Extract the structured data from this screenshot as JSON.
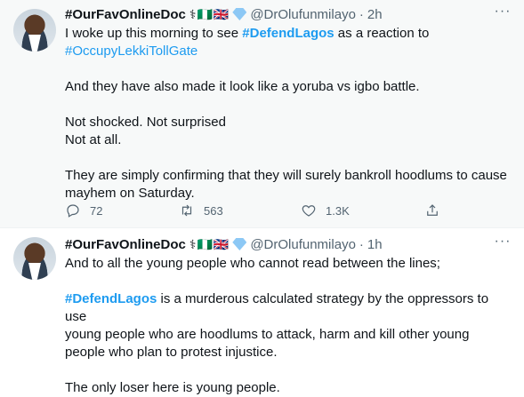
{
  "tweets": [
    {
      "name": "#OurFavOnlineDoc",
      "badges": "⚕🇳🇬🇬🇧",
      "handle": "@DrOlufunmilayo",
      "separator": "·",
      "time": "2h",
      "line1_prefix": "I woke up this morning to see ",
      "line1_hashtag": "#DefendLagos",
      "line1_suffix": " as a reaction to",
      "line2_hashtag": "#OccupyLekkiTollGate",
      "para2": "And they have also made it look like a yoruba vs igbo battle.",
      "para3_line1": "Not shocked. Not surprised",
      "para3_line2": "Not at all.",
      "para4_line1": "They are simply confirming that they will surely bankroll hoodlums to cause",
      "para4_line2": "mayhem on Saturday.",
      "reply_count": "72",
      "retweet_count": "563",
      "like_count": "1.3K"
    },
    {
      "name": "#OurFavOnlineDoc",
      "badges": "⚕🇳🇬🇬🇧",
      "handle": "@DrOlufunmilayo",
      "separator": "·",
      "time": "1h",
      "para1": "And to all the young people who cannot read between the lines;",
      "para2_hashtag": "#DefendLagos",
      "para2_line1_suffix": " is a murderous calculated strategy by the oppressors to use",
      "para2_line2": "young people who are hoodlums to attack, harm and kill other young",
      "para2_line3": "people who plan to protest injustice.",
      "para3": "The only loser here is young people."
    }
  ],
  "icons": {
    "more": "more-icon",
    "reply": "reply-icon",
    "retweet": "retweet-icon",
    "like": "like-icon",
    "share": "share-icon",
    "verified": "verified-badge-icon"
  },
  "colors": {
    "link": "#1d9bf0",
    "secondary_text": "#536471",
    "primary_text": "#0f1419",
    "highlight_bg": "#f7f9f9"
  }
}
